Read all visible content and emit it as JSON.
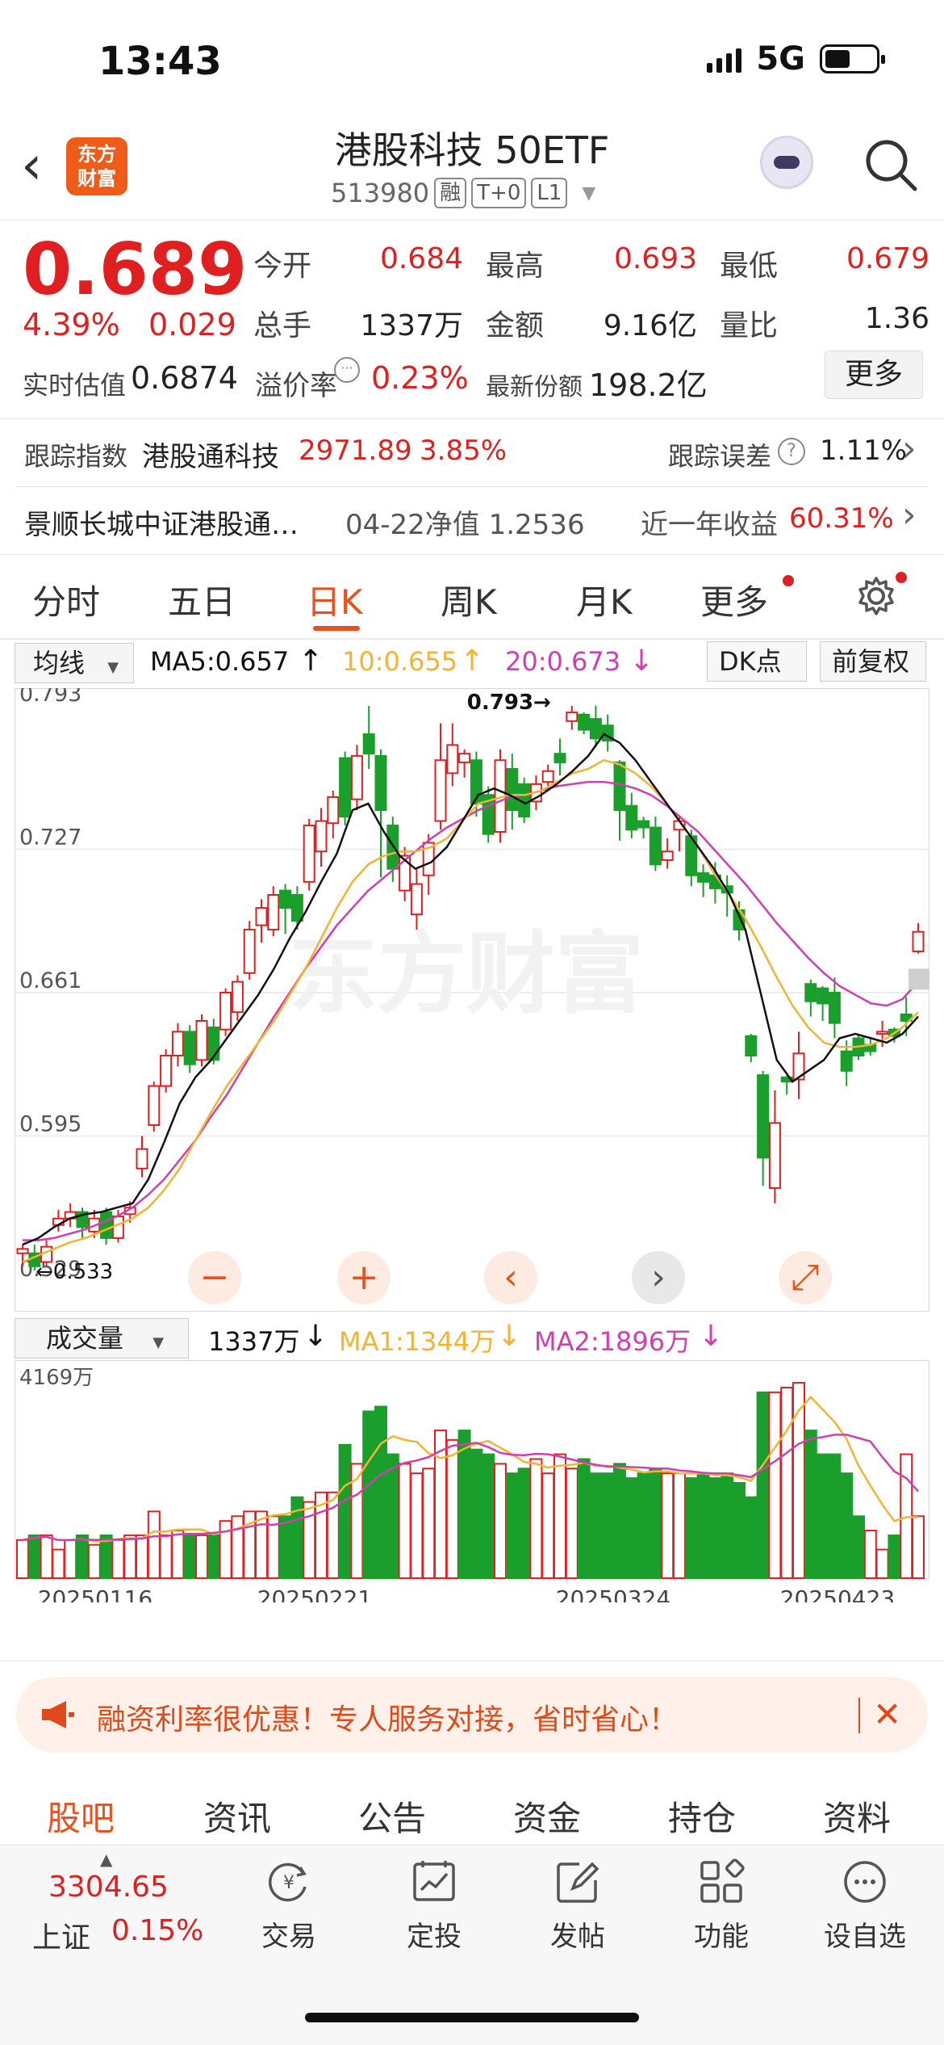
{
  "status": {
    "time": "13:43",
    "network": "5G"
  },
  "header": {
    "logo_text": "东方财富",
    "title": "港股科技 50ETF",
    "code": "513980",
    "tags": [
      "融",
      "T+0",
      "L1"
    ]
  },
  "quote": {
    "price": "0.689",
    "change_pct": "4.39%",
    "change_abs": "0.029",
    "open_label": "今开",
    "open": "0.684",
    "high_label": "最高",
    "high": "0.693",
    "low_label": "最低",
    "low": "0.679",
    "volume_label": "总手",
    "volume": "1337万",
    "amount_label": "金额",
    "amount": "9.16亿",
    "ratio_label": "量比",
    "ratio": "1.36",
    "est_label": "实时估值",
    "est": "0.6874",
    "premium_label": "溢价率",
    "premium": "0.23%",
    "latest_label": "最新份额",
    "latest": "198.2亿",
    "more_label": "更多"
  },
  "tracking": {
    "label": "跟踪指数",
    "index_name": "港股通科技",
    "index_value": "2971.89",
    "index_chg": "3.85%",
    "err_label": "跟踪误差",
    "err_value": "1.11%"
  },
  "fund_row": {
    "name": "景顺长城中证港股通…",
    "nav_text": "04-22净值 1.2536",
    "return_label": "近一年收益",
    "return_value": "60.31%"
  },
  "tabs": [
    "分时",
    "五日",
    "日K",
    "周K",
    "月K",
    "更多"
  ],
  "chart_controls": {
    "ma_select": "均线",
    "dk_label": "DK点",
    "restore_label": "前复权",
    "vol_select": "成交量"
  },
  "chart_data": {
    "type": "candlestick",
    "price_ticks": [
      "0.793",
      "0.727",
      "0.661",
      "0.595",
      "0.529"
    ],
    "ma_legend": {
      "ma5": "MA5:0.657",
      "ma10": "10:0.655",
      "ma20": "20:0.673"
    },
    "high_marker": "0.793",
    "low_marker": "0.533",
    "watermark": "东方财富",
    "volume_legend": {
      "current": "1337万",
      "ma1": "MA1:1344万",
      "ma2": "MA2:1896万"
    },
    "volume_max_label": "4169万",
    "date_labels": [
      "20250116",
      "20250221",
      "20250324",
      "20250423"
    ],
    "colors": {
      "up": "#e02020",
      "down": "#1a9e2c",
      "ma5": "#111111",
      "ma10": "#f3b431",
      "ma20": "#d03fb2"
    },
    "candles": [
      [
        0.541,
        0.543,
        0.535,
        0.545
      ],
      [
        0.541,
        0.535,
        0.533,
        0.545
      ],
      [
        0.537,
        0.544,
        0.535,
        0.547
      ],
      [
        0.554,
        0.557,
        0.551,
        0.561
      ],
      [
        0.557,
        0.56,
        0.553,
        0.564
      ],
      [
        0.56,
        0.553,
        0.548,
        0.562
      ],
      [
        0.551,
        0.557,
        0.548,
        0.561
      ],
      [
        0.56,
        0.548,
        0.545,
        0.562
      ],
      [
        0.548,
        0.558,
        0.546,
        0.561
      ],
      [
        0.559,
        0.562,
        0.555,
        0.565
      ],
      [
        0.58,
        0.589,
        0.576,
        0.595
      ],
      [
        0.6,
        0.618,
        0.597,
        0.62
      ],
      [
        0.618,
        0.632,
        0.615,
        0.635
      ],
      [
        0.632,
        0.643,
        0.627,
        0.647
      ],
      [
        0.643,
        0.628,
        0.624,
        0.646
      ],
      [
        0.63,
        0.648,
        0.627,
        0.651
      ],
      [
        0.645,
        0.63,
        0.628,
        0.649
      ],
      [
        0.644,
        0.661,
        0.641,
        0.663
      ],
      [
        0.652,
        0.666,
        0.648,
        0.669
      ],
      [
        0.67,
        0.69,
        0.667,
        0.694
      ],
      [
        0.692,
        0.7,
        0.684,
        0.704
      ],
      [
        0.69,
        0.706,
        0.687,
        0.71
      ],
      [
        0.708,
        0.7,
        0.688,
        0.711
      ],
      [
        0.706,
        0.694,
        0.69,
        0.71
      ],
      [
        0.712,
        0.738,
        0.708,
        0.741
      ],
      [
        0.726,
        0.74,
        0.719,
        0.746
      ],
      [
        0.739,
        0.751,
        0.732,
        0.754
      ],
      [
        0.769,
        0.742,
        0.738,
        0.772
      ],
      [
        0.75,
        0.77,
        0.745,
        0.775
      ],
      [
        0.78,
        0.771,
        0.764,
        0.793
      ],
      [
        0.77,
        0.745,
        0.714,
        0.773
      ],
      [
        0.738,
        0.718,
        0.712,
        0.742
      ],
      [
        0.708,
        0.724,
        0.703,
        0.728
      ],
      [
        0.697,
        0.711,
        0.69,
        0.718
      ],
      [
        0.715,
        0.73,
        0.706,
        0.734
      ],
      [
        0.74,
        0.768,
        0.736,
        0.785
      ],
      [
        0.762,
        0.775,
        0.756,
        0.785
      ],
      [
        0.767,
        0.771,
        0.76,
        0.773
      ],
      [
        0.768,
        0.748,
        0.742,
        0.772
      ],
      [
        0.752,
        0.734,
        0.73,
        0.756
      ],
      [
        0.735,
        0.768,
        0.73,
        0.773
      ],
      [
        0.764,
        0.745,
        0.736,
        0.771
      ],
      [
        0.757,
        0.742,
        0.739,
        0.76
      ],
      [
        0.749,
        0.757,
        0.745,
        0.761
      ],
      [
        0.758,
        0.763,
        0.754,
        0.766
      ],
      [
        0.771,
        0.767,
        0.761,
        0.778
      ],
      [
        0.786,
        0.79,
        0.782,
        0.793
      ],
      [
        0.789,
        0.782,
        0.78,
        0.79
      ],
      [
        0.787,
        0.778,
        0.774,
        0.793
      ],
      [
        0.784,
        0.777,
        0.772,
        0.789
      ],
      [
        0.767,
        0.745,
        0.731,
        0.768
      ],
      [
        0.747,
        0.736,
        0.732,
        0.753
      ],
      [
        0.74,
        0.737,
        0.732,
        0.742
      ],
      [
        0.737,
        0.72,
        0.717,
        0.742
      ],
      [
        0.722,
        0.726,
        0.718,
        0.732
      ],
      [
        0.736,
        0.74,
        0.726,
        0.742
      ],
      [
        0.733,
        0.715,
        0.71,
        0.736
      ],
      [
        0.716,
        0.712,
        0.705,
        0.72
      ],
      [
        0.715,
        0.709,
        0.702,
        0.721
      ],
      [
        0.71,
        0.707,
        0.696,
        0.715
      ],
      [
        0.699,
        0.69,
        0.685,
        0.703
      ],
      [
        0.641,
        0.632,
        0.629,
        0.642
      ],
      [
        0.623,
        0.585,
        0.572,
        0.625
      ],
      [
        0.571,
        0.601,
        0.564,
        0.616
      ],
      [
        0.622,
        0.62,
        0.614,
        0.623
      ],
      [
        0.621,
        0.633,
        0.612,
        0.643
      ],
      [
        0.665,
        0.657,
        0.65,
        0.667
      ],
      [
        0.663,
        0.656,
        0.648,
        0.664
      ],
      [
        0.661,
        0.647,
        0.64,
        0.668
      ],
      [
        0.634,
        0.625,
        0.618,
        0.639
      ],
      [
        0.64,
        0.632,
        0.63,
        0.642
      ],
      [
        0.637,
        0.634,
        0.632,
        0.64
      ],
      [
        0.642,
        0.643,
        0.636,
        0.648
      ],
      [
        0.644,
        0.641,
        0.638,
        0.645
      ],
      [
        0.651,
        0.648,
        0.641,
        0.659
      ],
      [
        0.68,
        0.689,
        0.679,
        0.693
      ]
    ],
    "volumes": [
      8,
      9,
      9,
      6,
      8,
      9,
      7,
      9,
      8,
      9,
      9,
      14,
      9,
      10,
      9,
      9,
      9,
      12,
      13,
      14,
      14,
      13,
      13,
      17,
      16,
      18,
      18,
      28,
      24,
      35,
      36,
      26,
      24,
      22,
      23,
      31,
      29,
      31,
      27,
      26,
      24,
      22,
      23,
      25,
      22,
      26,
      23,
      25,
      22,
      22,
      24,
      21,
      22,
      23,
      22,
      22,
      21,
      22,
      21,
      22,
      20,
      17,
      39,
      39,
      40,
      41,
      31,
      26,
      26,
      22,
      13,
      10,
      6,
      9,
      26,
      13
    ],
    "volume_up": [
      1,
      0,
      1,
      1,
      1,
      0,
      1,
      0,
      1,
      1,
      1,
      1,
      1,
      1,
      0,
      1,
      0,
      1,
      1,
      1,
      1,
      1,
      0,
      0,
      1,
      1,
      1,
      0,
      1,
      0,
      0,
      0,
      1,
      1,
      1,
      1,
      1,
      0,
      0,
      0,
      1,
      0,
      0,
      1,
      1,
      1,
      1,
      0,
      0,
      0,
      0,
      0,
      0,
      0,
      1,
      1,
      0,
      0,
      0,
      0,
      0,
      0,
      0,
      1,
      1,
      1,
      0,
      0,
      0,
      0,
      0,
      1,
      1,
      0,
      1,
      1
    ],
    "ma_series": {
      "ma5": [
        0.545,
        0.548,
        0.553,
        0.557,
        0.559,
        0.56,
        0.562,
        0.564,
        0.575,
        0.592,
        0.61,
        0.622,
        0.63,
        0.64,
        0.65,
        0.66,
        0.672,
        0.686,
        0.698,
        0.712,
        0.725,
        0.745,
        0.748,
        0.735,
        0.724,
        0.718,
        0.721,
        0.728,
        0.74,
        0.752,
        0.755,
        0.752,
        0.748,
        0.752,
        0.757,
        0.763,
        0.77,
        0.78,
        0.776,
        0.768,
        0.758,
        0.748,
        0.738,
        0.728,
        0.718,
        0.706,
        0.69,
        0.66,
        0.63,
        0.62,
        0.625,
        0.63,
        0.64,
        0.642,
        0.64,
        0.638,
        0.642,
        0.65
      ],
      "ma10": [
        0.537,
        0.54,
        0.543,
        0.546,
        0.548,
        0.551,
        0.554,
        0.557,
        0.562,
        0.57,
        0.58,
        0.593,
        0.606,
        0.618,
        0.628,
        0.638,
        0.648,
        0.66,
        0.672,
        0.686,
        0.7,
        0.712,
        0.72,
        0.724,
        0.726,
        0.726,
        0.728,
        0.732,
        0.74,
        0.748,
        0.75,
        0.752,
        0.752,
        0.754,
        0.758,
        0.762,
        0.764,
        0.768,
        0.766,
        0.762,
        0.756,
        0.748,
        0.738,
        0.728,
        0.716,
        0.706,
        0.695,
        0.682,
        0.668,
        0.655,
        0.645,
        0.638,
        0.636,
        0.636,
        0.637,
        0.64,
        0.645,
        0.652
      ],
      "ma20": [
        0.547,
        0.547,
        0.548,
        0.55,
        0.552,
        0.555,
        0.558,
        0.562,
        0.568,
        0.575,
        0.584,
        0.593,
        0.604,
        0.614,
        0.626,
        0.638,
        0.65,
        0.661,
        0.672,
        0.682,
        0.692,
        0.7,
        0.708,
        0.714,
        0.72,
        0.726,
        0.732,
        0.737,
        0.741,
        0.745,
        0.748,
        0.751,
        0.752,
        0.754,
        0.756,
        0.757,
        0.758,
        0.758,
        0.757,
        0.755,
        0.752,
        0.747,
        0.741,
        0.735,
        0.727,
        0.719,
        0.711,
        0.702,
        0.693,
        0.685,
        0.677,
        0.67,
        0.664,
        0.66,
        0.656,
        0.655,
        0.658,
        0.666
      ]
    }
  },
  "banner": {
    "text": "融资利率很优惠！专人服务对接，省时省心！"
  },
  "sub_tabs": [
    "股吧",
    "资讯",
    "公告",
    "资金",
    "持仓",
    "资料"
  ],
  "bottom": {
    "index_value": "3304.65",
    "index_label": "上证",
    "index_chg": "0.15%",
    "items": [
      "交易",
      "定投",
      "发帖",
      "功能",
      "设自选"
    ]
  }
}
